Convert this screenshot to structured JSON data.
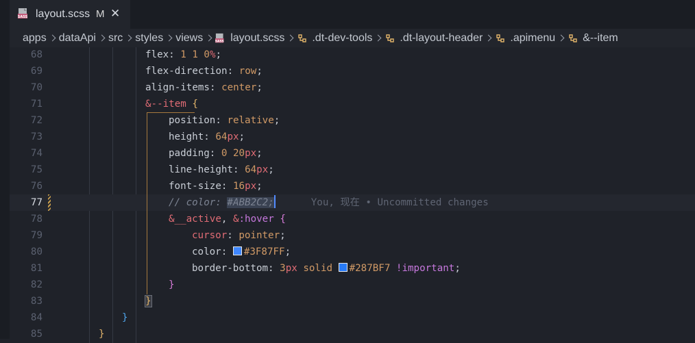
{
  "tab": {
    "title": "layout.scss",
    "status": "M",
    "close": "✕"
  },
  "breadcrumbs": [
    {
      "label": "apps",
      "icon": ""
    },
    {
      "label": "dataApi",
      "icon": ""
    },
    {
      "label": "src",
      "icon": ""
    },
    {
      "label": "styles",
      "icon": ""
    },
    {
      "label": "views",
      "icon": ""
    },
    {
      "label": "layout.scss",
      "icon": "sass-file-icon"
    },
    {
      "label": ".dt-dev-tools",
      "icon": "selector-icon"
    },
    {
      "label": ".dt-layout-header",
      "icon": "selector-icon"
    },
    {
      "label": ".apimenu",
      "icon": "selector-icon"
    },
    {
      "label": "&--item",
      "icon": "selector-icon"
    }
  ],
  "editor": {
    "current_line": "77",
    "blame": "You, 现在 • Uncommitted changes",
    "lines": [
      {
        "num": "68",
        "indent": 4,
        "tokens": [
          [
            "prop",
            "flex"
          ],
          [
            "punc",
            ": "
          ],
          [
            "num",
            "1 1 0"
          ],
          [
            "unit",
            "%"
          ],
          [
            "punc",
            ";"
          ]
        ]
      },
      {
        "num": "69",
        "indent": 4,
        "tokens": [
          [
            "prop",
            "flex-direction"
          ],
          [
            "punc",
            ": "
          ],
          [
            "val",
            "row"
          ],
          [
            "punc",
            ";"
          ]
        ]
      },
      {
        "num": "70",
        "indent": 4,
        "tokens": [
          [
            "prop",
            "align-items"
          ],
          [
            "punc",
            ": "
          ],
          [
            "val",
            "center"
          ],
          [
            "punc",
            ";"
          ]
        ]
      },
      {
        "num": "71",
        "indent": 4,
        "tokens": [
          [
            "sel",
            "&--item"
          ],
          [
            "punc",
            " "
          ],
          [
            "brace",
            "{"
          ]
        ]
      },
      {
        "num": "72",
        "indent": 5,
        "tokens": [
          [
            "prop",
            "position"
          ],
          [
            "punc",
            ": "
          ],
          [
            "val",
            "relative"
          ],
          [
            "punc",
            ";"
          ]
        ]
      },
      {
        "num": "73",
        "indent": 5,
        "tokens": [
          [
            "prop",
            "height"
          ],
          [
            "punc",
            ": "
          ],
          [
            "num",
            "64"
          ],
          [
            "unit",
            "px"
          ],
          [
            "punc",
            ";"
          ]
        ]
      },
      {
        "num": "74",
        "indent": 5,
        "tokens": [
          [
            "prop",
            "padding"
          ],
          [
            "punc",
            ": "
          ],
          [
            "num",
            "0 20"
          ],
          [
            "unit",
            "px"
          ],
          [
            "punc",
            ";"
          ]
        ]
      },
      {
        "num": "75",
        "indent": 5,
        "tokens": [
          [
            "prop",
            "line-height"
          ],
          [
            "punc",
            ": "
          ],
          [
            "num",
            "64"
          ],
          [
            "unit",
            "px"
          ],
          [
            "punc",
            ";"
          ]
        ]
      },
      {
        "num": "76",
        "indent": 5,
        "tokens": [
          [
            "prop",
            "font-size"
          ],
          [
            "punc",
            ": "
          ],
          [
            "num",
            "16"
          ],
          [
            "unit",
            "px"
          ],
          [
            "punc",
            ";"
          ]
        ]
      },
      {
        "num": "77",
        "indent": 5,
        "tokens": [
          [
            "comment",
            "// color: "
          ],
          [
            "commenthl",
            "#ABB2C2;"
          ],
          [
            "cursor",
            ""
          ]
        ]
      },
      {
        "num": "78",
        "indent": 5,
        "tokens": [
          [
            "sel",
            "&__active"
          ],
          [
            "punc",
            ", "
          ],
          [
            "sel",
            "&"
          ],
          [
            "hover",
            ":hover"
          ],
          [
            "punc",
            " "
          ],
          [
            "brace2",
            "{"
          ]
        ]
      },
      {
        "num": "79",
        "indent": 6,
        "tokens": [
          [
            "propred",
            "cursor"
          ],
          [
            "punc",
            ": "
          ],
          [
            "val",
            "pointer"
          ],
          [
            "punc",
            ";"
          ]
        ]
      },
      {
        "num": "80",
        "indent": 6,
        "tokens": [
          [
            "prop",
            "color"
          ],
          [
            "punc",
            ": "
          ],
          [
            "swatch",
            "#3F87FF"
          ],
          [
            "val",
            "#3F87FF"
          ],
          [
            "punc",
            ";"
          ]
        ]
      },
      {
        "num": "81",
        "indent": 6,
        "tokens": [
          [
            "prop",
            "border-bottom"
          ],
          [
            "punc",
            ": "
          ],
          [
            "num",
            "3"
          ],
          [
            "unit",
            "px"
          ],
          [
            "val",
            " solid "
          ],
          [
            "swatch",
            "#287BF7"
          ],
          [
            "val",
            "#287BF7"
          ],
          [
            "imp",
            " !important"
          ],
          [
            "punc",
            ";"
          ]
        ]
      },
      {
        "num": "82",
        "indent": 5,
        "tokens": [
          [
            "brace2",
            "}"
          ]
        ]
      },
      {
        "num": "83",
        "indent": 4,
        "tokens": [
          [
            "bracebox",
            "}"
          ]
        ]
      },
      {
        "num": "84",
        "indent": 3,
        "tokens": [
          [
            "brace3",
            "}"
          ]
        ]
      },
      {
        "num": "85",
        "indent": 2,
        "tokens": [
          [
            "brace",
            "}"
          ]
        ]
      }
    ]
  },
  "colors": {
    "modified_gutter": "#c49a4b",
    "accent": "#528bff"
  }
}
